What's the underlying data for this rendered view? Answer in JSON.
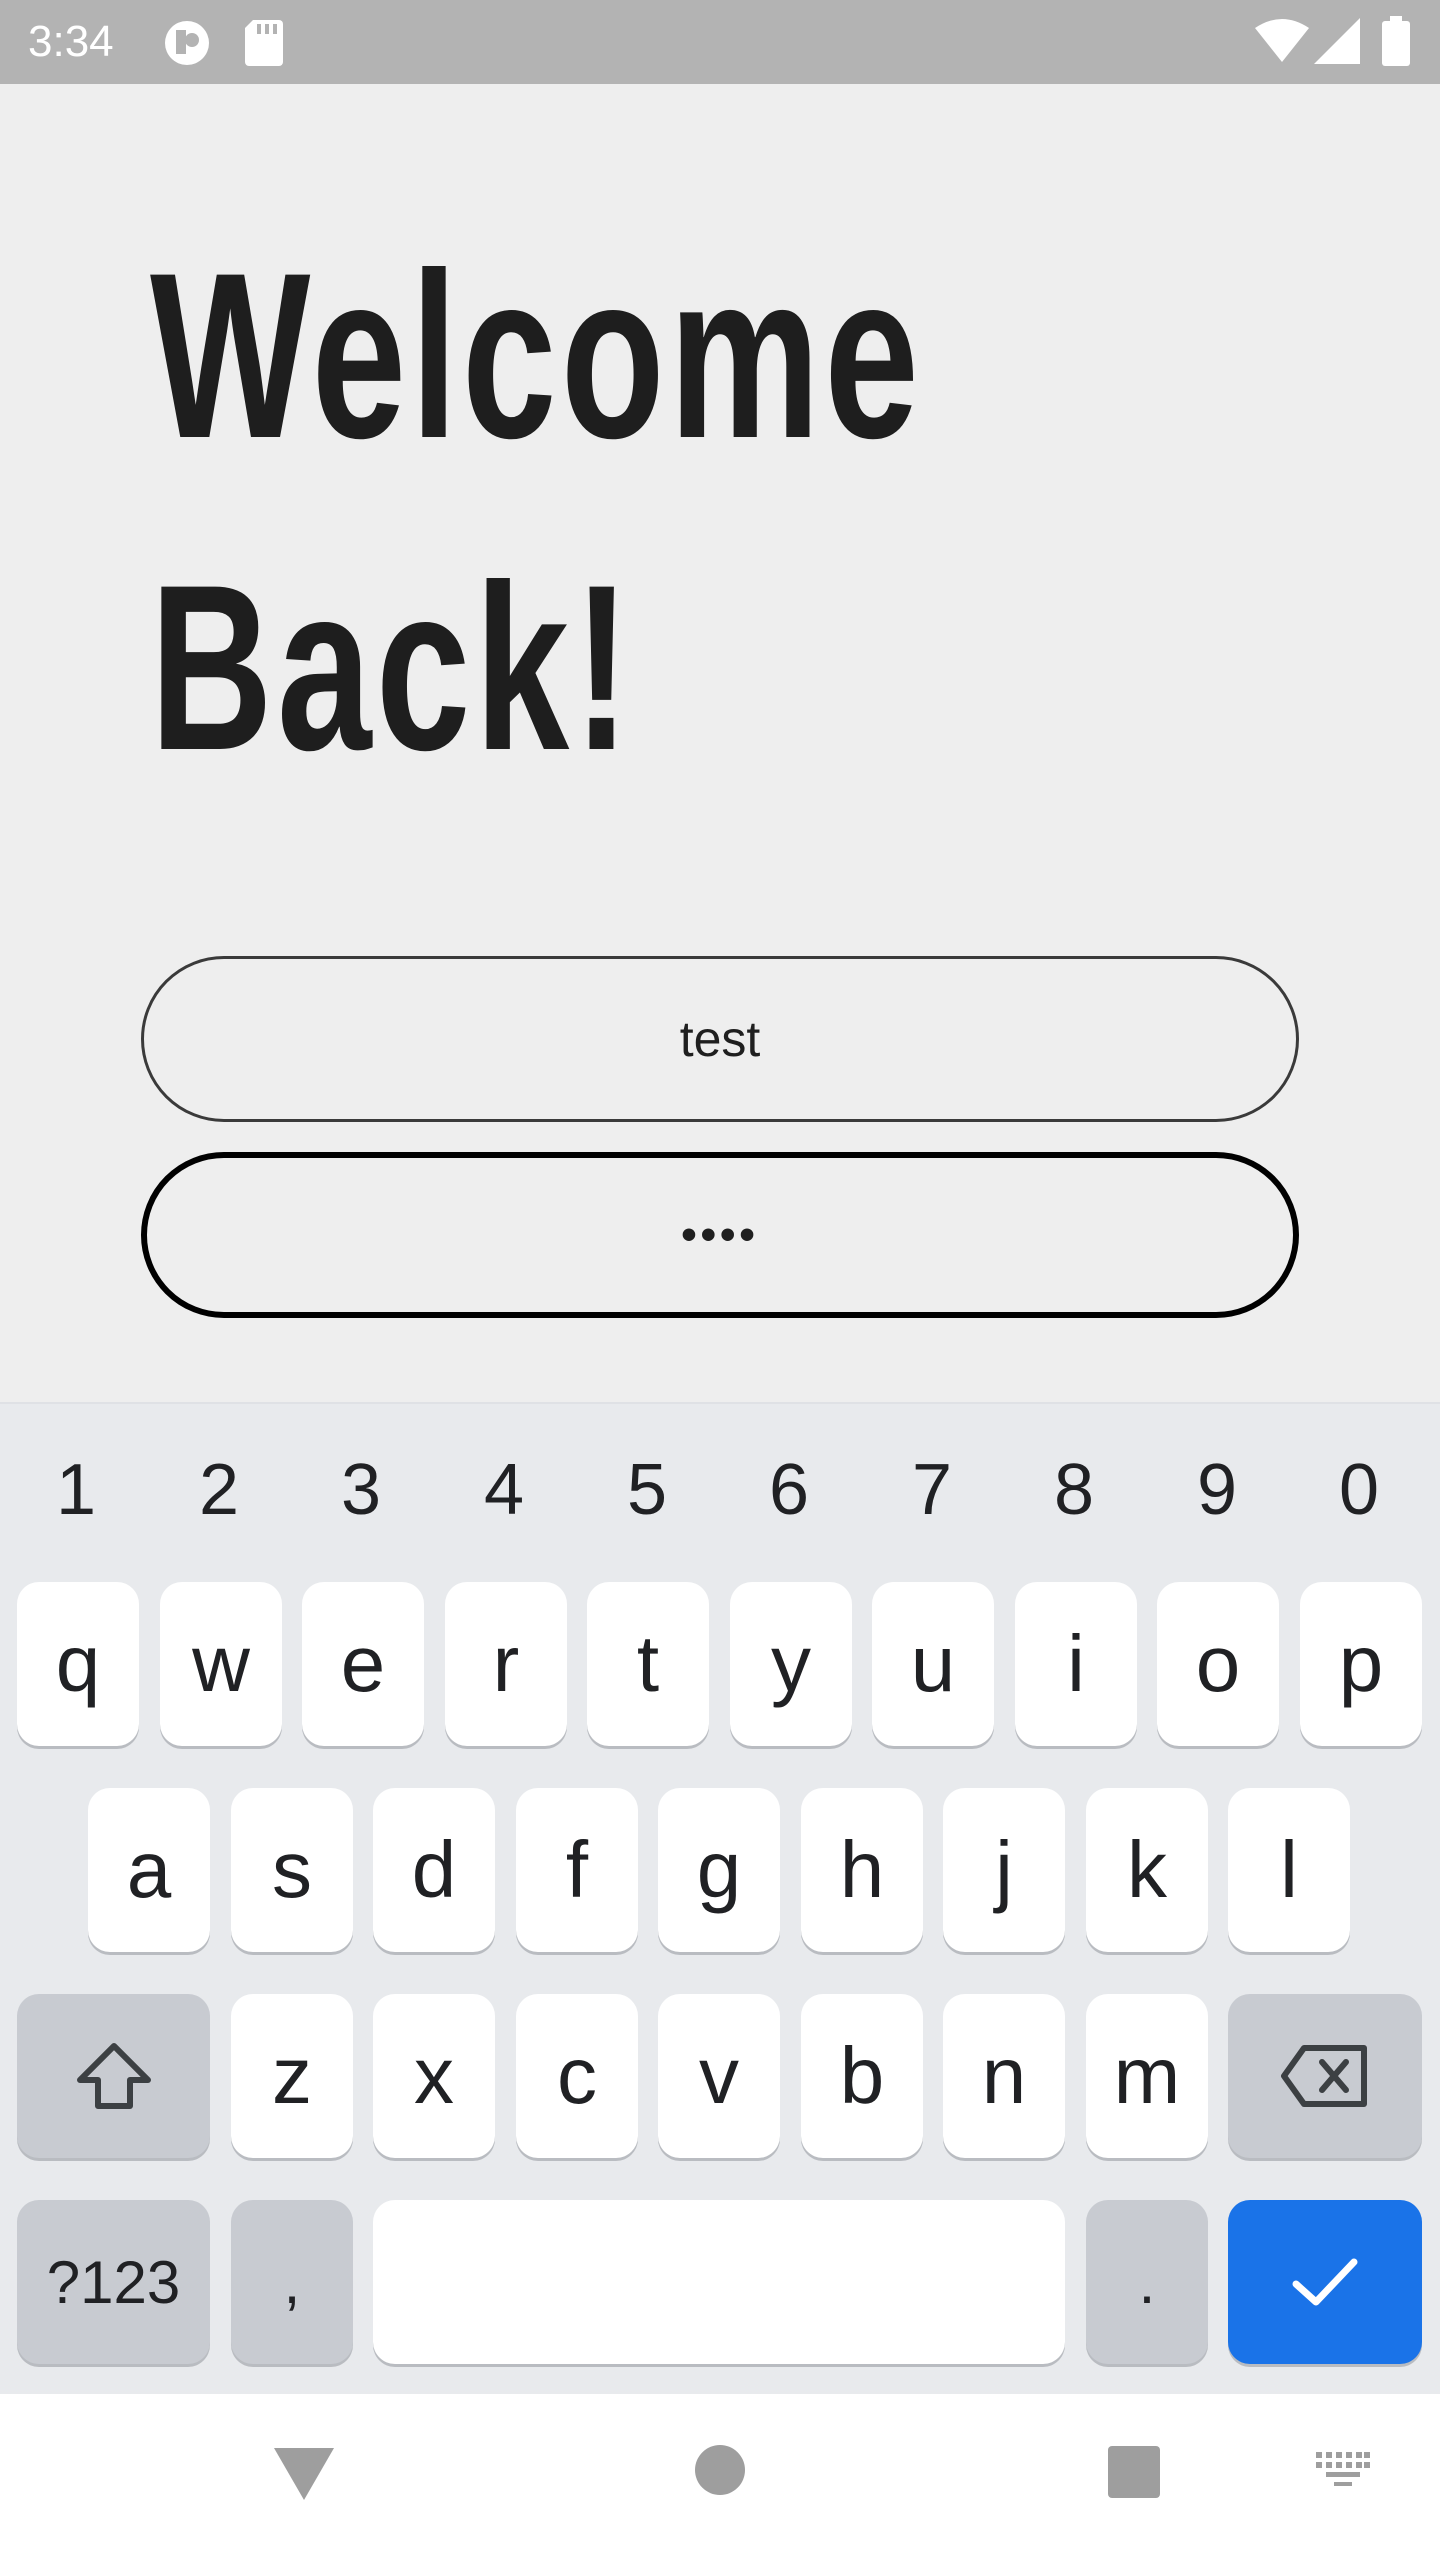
{
  "status_bar": {
    "time": "3:34",
    "icons": [
      "app-notification-icon",
      "sd-card-icon",
      "wifi-icon",
      "signal-icon",
      "battery-icon"
    ]
  },
  "header": {
    "line1": "Welcome",
    "line2": "Back!"
  },
  "form": {
    "username_value": "test",
    "password_mask": "••••"
  },
  "keyboard": {
    "number_row": [
      "1",
      "2",
      "3",
      "4",
      "5",
      "6",
      "7",
      "8",
      "9",
      "0"
    ],
    "row1": [
      "q",
      "w",
      "e",
      "r",
      "t",
      "y",
      "u",
      "i",
      "o",
      "p"
    ],
    "row2": [
      "a",
      "s",
      "d",
      "f",
      "g",
      "h",
      "j",
      "k",
      "l"
    ],
    "row3": [
      "z",
      "x",
      "c",
      "v",
      "b",
      "n",
      "m"
    ],
    "symbols_label": "?123",
    "comma_label": ",",
    "period_label": ".",
    "enter_color": "#1a73e8"
  },
  "nav_bar": {
    "icons": [
      "back-icon",
      "home-icon",
      "recents-icon",
      "keyboard-switch-icon"
    ]
  }
}
